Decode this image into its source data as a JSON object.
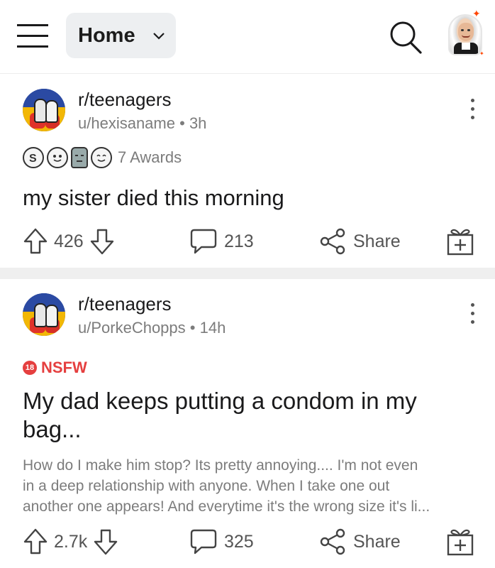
{
  "header": {
    "feed_label": "Home"
  },
  "posts": [
    {
      "subreddit": "r/teenagers",
      "user": "u/hexisaname",
      "age": "3h",
      "awards_label": "7 Awards",
      "nsfw": false,
      "title": "my sister died this morning",
      "votes": "426",
      "comments": "213",
      "share_label": "Share"
    },
    {
      "subreddit": "r/teenagers",
      "user": "u/PorkeChopps",
      "age": "14h",
      "nsfw_label": "NSFW",
      "nsfw_badge": "18",
      "title": "My dad keeps putting a condom in my bag...",
      "body_lines": [
        "How do I make him stop? Its pretty annoying.... I'm not even",
        "in a deep relationship with anyone. When I take one out",
        "another one appears! And everytime it's the wrong size it's li..."
      ],
      "votes": "2.7k",
      "comments": "325",
      "share_label": "Share"
    }
  ],
  "colors": {
    "nsfw": "#e53f3f",
    "meta_text": "#7c7c7c",
    "home_pill": "#edeff1",
    "divider": "#efefef"
  }
}
